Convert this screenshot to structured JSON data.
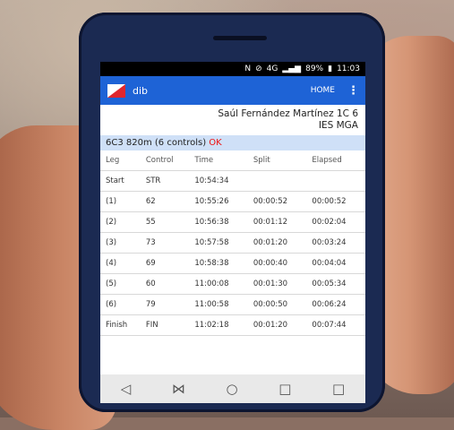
{
  "status": {
    "icons": [
      "nfc-icon",
      "mute-icon",
      "4g-icon",
      "signal-icon"
    ],
    "battery": "89%",
    "time": "11:03"
  },
  "app": {
    "title": "dib",
    "home_label": "HOME",
    "brand_color": "#1e63d6",
    "accent_color": "#e0262e"
  },
  "runner": {
    "name_line": "Saúl Fernández Martínez  1C 6",
    "school": "IES MGA"
  },
  "course": {
    "label": "6C3 820m (6 controls)",
    "result": "OK"
  },
  "table": {
    "headers": [
      "Leg",
      "Control",
      "Time",
      "Split",
      "Elapsed"
    ],
    "rows": [
      [
        "Start",
        "STR",
        "10:54:34",
        "",
        ""
      ],
      [
        "(1)",
        "62",
        "10:55:26",
        "00:00:52",
        "00:00:52"
      ],
      [
        "(2)",
        "55",
        "10:56:38",
        "00:01:12",
        "00:02:04"
      ],
      [
        "(3)",
        "73",
        "10:57:58",
        "00:01:20",
        "00:03:24"
      ],
      [
        "(4)",
        "69",
        "10:58:38",
        "00:00:40",
        "00:04:04"
      ],
      [
        "(5)",
        "60",
        "11:00:08",
        "00:01:30",
        "00:05:34"
      ],
      [
        "(6)",
        "79",
        "11:00:58",
        "00:00:50",
        "00:06:24"
      ],
      [
        "Finish",
        "FIN",
        "11:02:18",
        "00:01:20",
        "00:07:44"
      ]
    ]
  },
  "navbar": {
    "back": "◁",
    "split": "⋈",
    "home": "○",
    "recents": "□",
    "extra": "□"
  }
}
